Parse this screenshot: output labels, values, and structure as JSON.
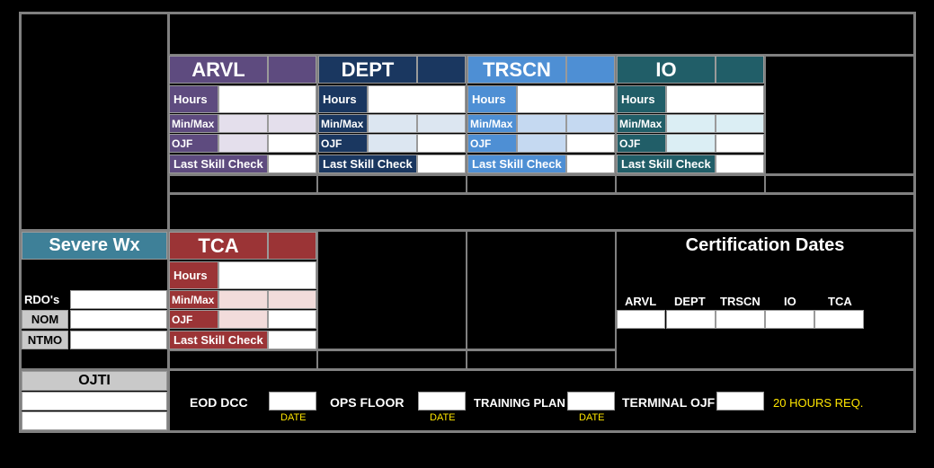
{
  "colors": {
    "arvl": "#5e4b7f",
    "arvl_light": "#e4dfec",
    "dept": "#1a3760",
    "dept_light": "#dce6f1",
    "trscn": "#4e8fd4",
    "trscn_light": "#c5d9f1",
    "io": "#215e68",
    "io_light": "#dbeef4",
    "tca": "#9b3436",
    "tca_light": "#f2dcdb",
    "severe": "#3e8098",
    "grid": "#808080",
    "yellow": "#ffe600"
  },
  "positions": [
    {
      "key": "arvl",
      "title": "ARVL",
      "hours": "Hours",
      "minmax": "Min/Max",
      "ojf": "OJF",
      "last_skill": "Last Skill Check"
    },
    {
      "key": "dept",
      "title": "DEPT",
      "hours": "Hours",
      "minmax": "Min/Max",
      "ojf": "OJF",
      "last_skill": "Last Skill Check"
    },
    {
      "key": "trscn",
      "title": "TRSCN",
      "hours": "Hours",
      "minmax": "Min/Max",
      "ojf": "OJF",
      "last_skill": "Last Skill Check"
    },
    {
      "key": "io",
      "title": "IO",
      "hours": "Hours",
      "minmax": "Min/Max",
      "ojf": "OJF",
      "last_skill": "Last Skill Check"
    }
  ],
  "tca": {
    "title": "TCA",
    "hours": "Hours",
    "minmax": "Min/Max",
    "ojf": "OJF",
    "last_skill": "Last Skill Check"
  },
  "severe_wx": {
    "title": "Severe Wx",
    "rows": [
      "RDO's",
      "NOM",
      "NTMO"
    ]
  },
  "certification": {
    "title": "Certification Dates",
    "columns": [
      "ARVL",
      "DEPT",
      "TRSCN",
      "IO",
      "TCA"
    ]
  },
  "ojti": {
    "title": "OJTI"
  },
  "bottom": {
    "eod_dcc": "EOD DCC",
    "ops_floor": "OPS FLOOR",
    "training_plan": "TRAINING PLAN",
    "terminal_ojf": "TERMINAL OJF",
    "date_label": "DATE",
    "hours_req": "20 HOURS REQ."
  }
}
